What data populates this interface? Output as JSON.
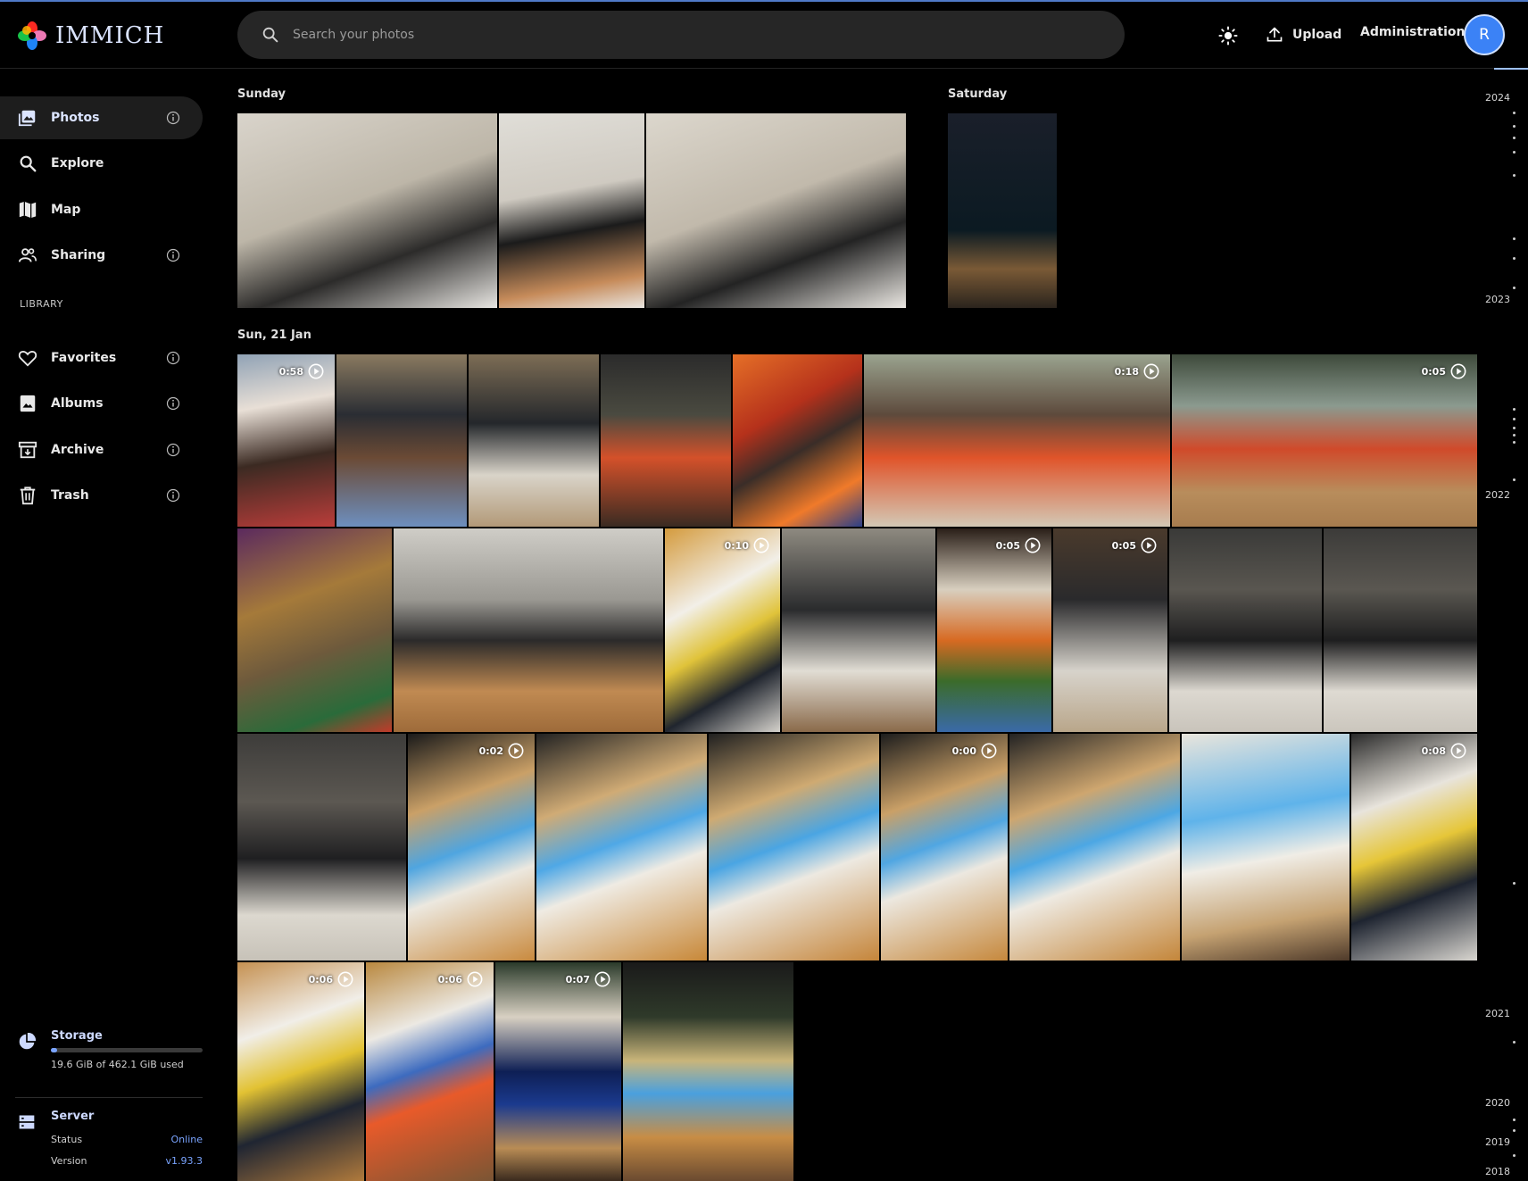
{
  "app": {
    "name": "IMMICH"
  },
  "header": {
    "search_placeholder": "Search your photos",
    "upload_label": "Upload",
    "admin_label": "Administration",
    "avatar_initial": "R"
  },
  "sidebar": {
    "items": [
      {
        "label": "Photos",
        "icon": "photos-icon",
        "active": true,
        "info": true
      },
      {
        "label": "Explore",
        "icon": "magnify-icon",
        "info": false
      },
      {
        "label": "Map",
        "icon": "map-icon",
        "info": false
      },
      {
        "label": "Sharing",
        "icon": "people-icon",
        "info": true
      }
    ],
    "library_label": "LIBRARY",
    "library": [
      {
        "label": "Favorites",
        "icon": "heart-icon",
        "info": true
      },
      {
        "label": "Albums",
        "icon": "album-icon",
        "info": true
      },
      {
        "label": "Archive",
        "icon": "archive-icon",
        "info": true
      },
      {
        "label": "Trash",
        "icon": "trash-icon",
        "info": true
      }
    ],
    "storage": {
      "title": "Storage",
      "used_text": "19.6 GiB of 462.1 GiB used",
      "used_fraction": 0.042
    },
    "server": {
      "title": "Server",
      "status_label": "Status",
      "status_value": "Online",
      "version_label": "Version",
      "version_value": "v1.93.3"
    }
  },
  "timeline": {
    "groups": [
      {
        "label": "Sunday"
      },
      {
        "label": "Saturday"
      },
      {
        "label": "Sun, 21 Jan"
      }
    ],
    "durations": [
      "0:58",
      "0:18",
      "0:05",
      "0:10",
      "0:05",
      "0:05",
      "0:02",
      "0:00",
      "0:08",
      "0:06",
      "0:06",
      "0:07"
    ]
  },
  "scrubber": {
    "years": [
      "2024",
      "2023",
      "2022",
      "2021",
      "2020",
      "2019",
      "2018"
    ]
  },
  "colors": {
    "accent": "#3b82f6",
    "link": "#7aa4ff",
    "background": "#000000"
  }
}
